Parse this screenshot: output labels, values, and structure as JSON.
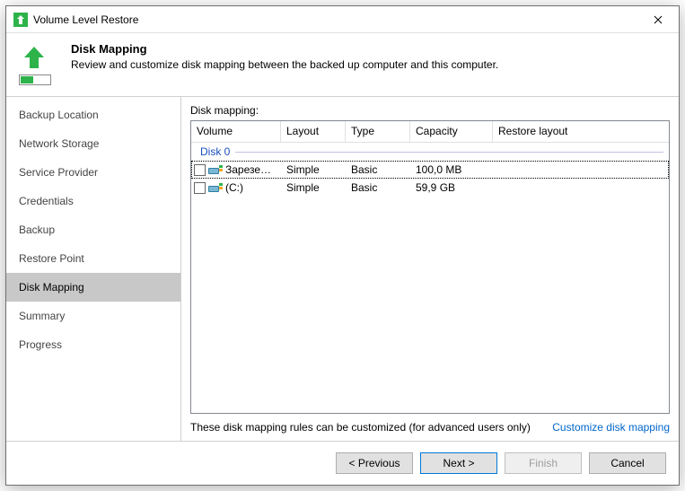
{
  "window": {
    "title": "Volume Level Restore"
  },
  "header": {
    "title": "Disk Mapping",
    "subtitle": "Review and customize disk mapping between the backed up computer and this computer."
  },
  "sidebar": {
    "items": [
      {
        "label": "Backup Location"
      },
      {
        "label": "Network Storage"
      },
      {
        "label": "Service Provider"
      },
      {
        "label": "Credentials"
      },
      {
        "label": "Backup"
      },
      {
        "label": "Restore Point"
      },
      {
        "label": "Disk Mapping",
        "active": true
      },
      {
        "label": "Summary"
      },
      {
        "label": "Progress"
      }
    ]
  },
  "main": {
    "label": "Disk mapping:",
    "columns": {
      "volume": "Volume",
      "layout": "Layout",
      "type": "Type",
      "capacity": "Capacity",
      "restore": "Restore layout"
    },
    "disk_group": "Disk 0",
    "rows": [
      {
        "name": "Зарезерви...",
        "layout": "Simple",
        "type": "Basic",
        "capacity": "100,0 MB",
        "restore": "",
        "selected": true
      },
      {
        "name": "(C:)",
        "layout": "Simple",
        "type": "Basic",
        "capacity": "59,9 GB",
        "restore": "",
        "selected": false
      }
    ],
    "note": "These disk mapping rules can be customized (for advanced users only)",
    "customize_link": "Customize disk mapping"
  },
  "buttons": {
    "previous": "< Previous",
    "next": "Next >",
    "finish": "Finish",
    "cancel": "Cancel"
  }
}
